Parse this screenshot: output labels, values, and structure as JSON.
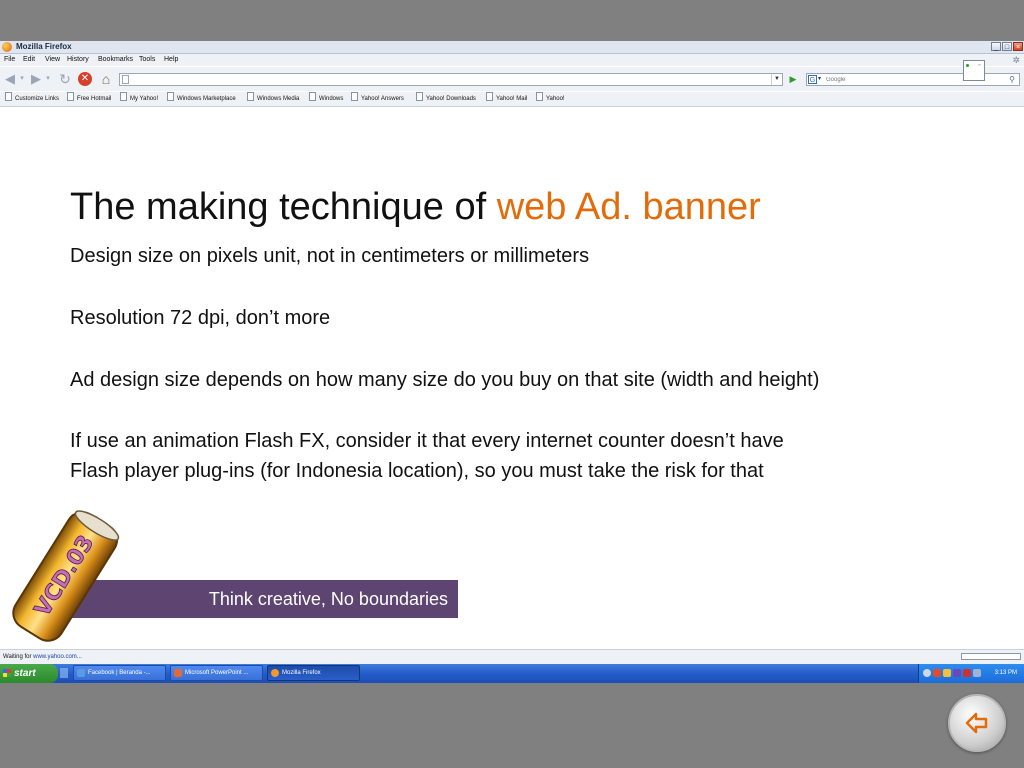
{
  "window": {
    "title": "Mozilla Firefox",
    "controls": {
      "minimize": "_",
      "maximize": "□",
      "close": "×"
    }
  },
  "menu": [
    "File",
    "Edit",
    "View",
    "History",
    "Bookmarks",
    "Tools",
    "Help"
  ],
  "search": {
    "placeholder": "Google"
  },
  "bookmarks": [
    "Customize Links",
    "Free Hotmail",
    "My Yahoo!",
    "Windows Marketplace",
    "Windows Media",
    "Windows",
    "Yahoo! Answers",
    "Yahoo! Downloads",
    "Yahoo! Mail",
    "Yahoo!"
  ],
  "slide": {
    "title_main": "The making technique  of ",
    "title_accent": "web Ad. banner",
    "bullets": [
      "Design size on pixels unit, not in centimeters or millimeters",
      "Resolution 72 dpi, don’t more",
      "Ad design size depends on how many size do you buy on that site (width and height)",
      "If use an animation Flash FX, consider it that every internet counter doesn’t have",
      "Flash player plug-ins (for Indonesia location), so you must take the risk for that"
    ],
    "tagline": "Think creative, No boundaries",
    "can_text": "VCD.03"
  },
  "status": {
    "prefix": "Waiting for ",
    "url": "www.yahoo.com..."
  },
  "taskbar": {
    "start": "start",
    "tasks": [
      "Facebook | Beranda -...",
      "Microsoft PowerPoint ...",
      "Mozilla Firefox"
    ],
    "clock": "3:13 PM"
  },
  "colors": {
    "accent": "#e36c0a",
    "tagline_band": "#5e4470"
  }
}
